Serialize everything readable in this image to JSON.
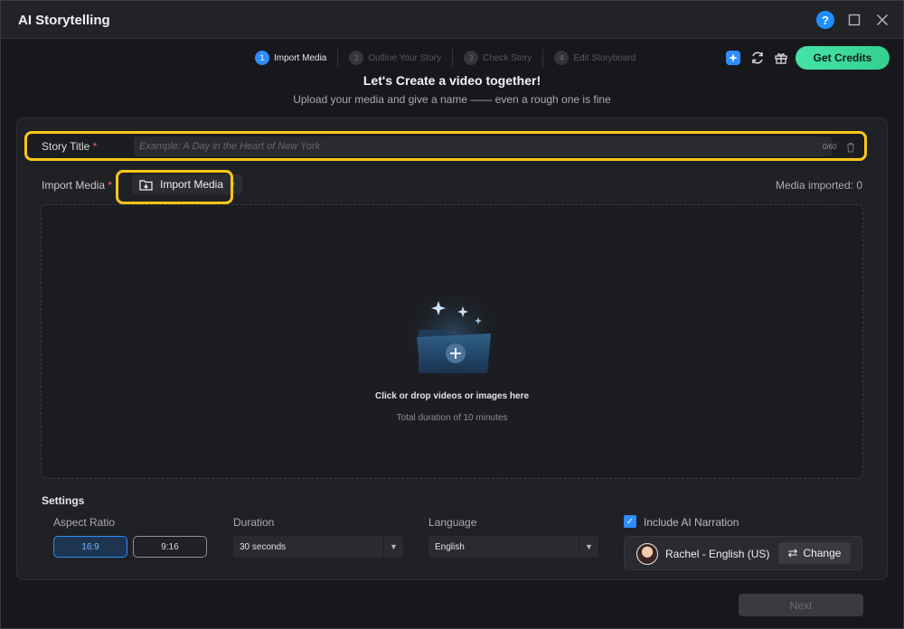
{
  "window": {
    "title": "AI Storytelling"
  },
  "titlebar": {
    "help_glyph": "?"
  },
  "steps": [
    {
      "num": "1",
      "label": "Import Media"
    },
    {
      "num": "2",
      "label": "Outline Your Story"
    },
    {
      "num": "3",
      "label": "Check Story"
    },
    {
      "num": "4",
      "label": "Edit Storyboard"
    }
  ],
  "header": {
    "credits_label": "Get Credits",
    "headline": "Let's Create a video together!",
    "subline": "Upload your media and give a name —— even a rough one is fine"
  },
  "story_title": {
    "label": "Story Title",
    "required_mark": "*",
    "placeholder": "Example: A Day in the Heart of New York",
    "value": "",
    "counter": "0/60"
  },
  "import_media": {
    "label": "Import Media",
    "required_mark": "*",
    "button_label": "Import Media",
    "media_count_text": "Media imported: 0"
  },
  "dropzone": {
    "title": "Click or drop videos or images here",
    "subtitle": "Total duration of 10 minutes"
  },
  "settings": {
    "heading": "Settings",
    "aspect_ratio": {
      "label": "Aspect Ratio",
      "options": [
        "16:9",
        "9:16"
      ],
      "selected": "16:9"
    },
    "duration": {
      "label": "Duration",
      "value": "30 seconds"
    },
    "language": {
      "label": "Language",
      "value": "English"
    },
    "narration": {
      "label": "Include AI Narration",
      "checked": true,
      "voice": "Rachel - English (US)",
      "change_label": "Change"
    }
  },
  "footer": {
    "next_label": "Next"
  },
  "colors": {
    "accent": "#2f8cff",
    "credits": "#3ddc9a",
    "highlight": "#ffc61a"
  }
}
